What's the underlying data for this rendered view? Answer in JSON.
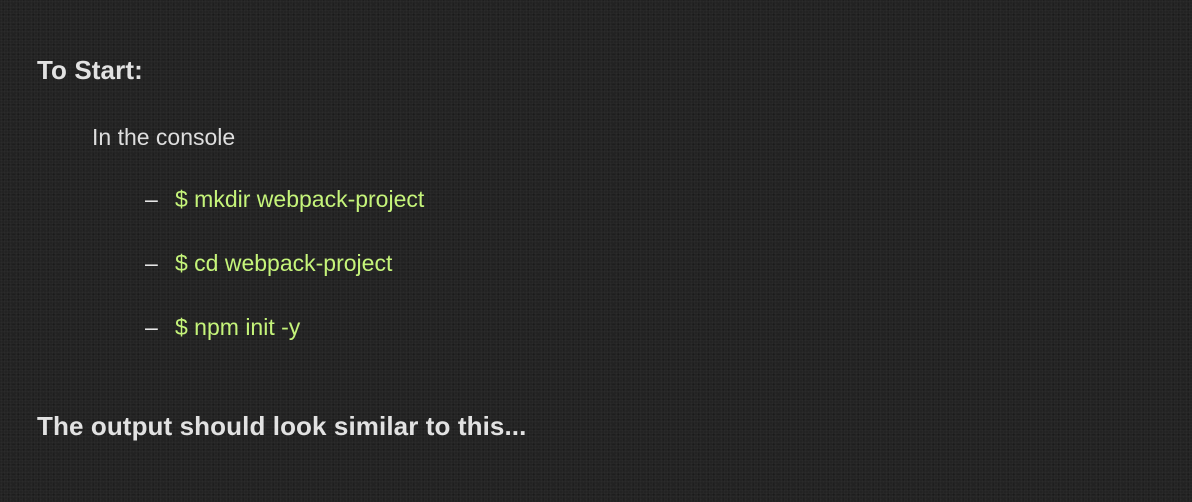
{
  "section_start": {
    "heading": "To Start:",
    "intro": "In the console",
    "bullet": "–",
    "commands": [
      "$ mkdir webpack-project",
      "$ cd webpack-project",
      "$ npm init -y"
    ]
  },
  "section_output": {
    "heading": "The output should look similar to this..."
  },
  "colors": {
    "background": "#232323",
    "text": "#e2e2e2",
    "command": "#c5f47a"
  }
}
